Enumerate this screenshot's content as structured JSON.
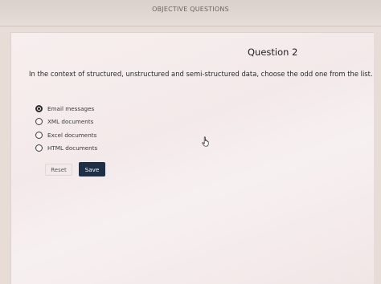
{
  "header": {
    "title": "OBJECTIVE QUESTIONS"
  },
  "question": {
    "title": "Question 2",
    "text": "In the context of structured, unstructured and semi-structured data, choose the odd one from the list.",
    "options": [
      {
        "label": "Email messages",
        "selected": true
      },
      {
        "label": "XML documents",
        "selected": false
      },
      {
        "label": "Excel documents",
        "selected": false
      },
      {
        "label": "HTML documents",
        "selected": false
      }
    ]
  },
  "actions": {
    "reset_label": "Reset",
    "save_label": "Save"
  },
  "colors": {
    "save_button": "#1f2f45",
    "page_background": "#e8dcd7"
  },
  "icons": {
    "cursor": "hand-pointer-icon"
  }
}
